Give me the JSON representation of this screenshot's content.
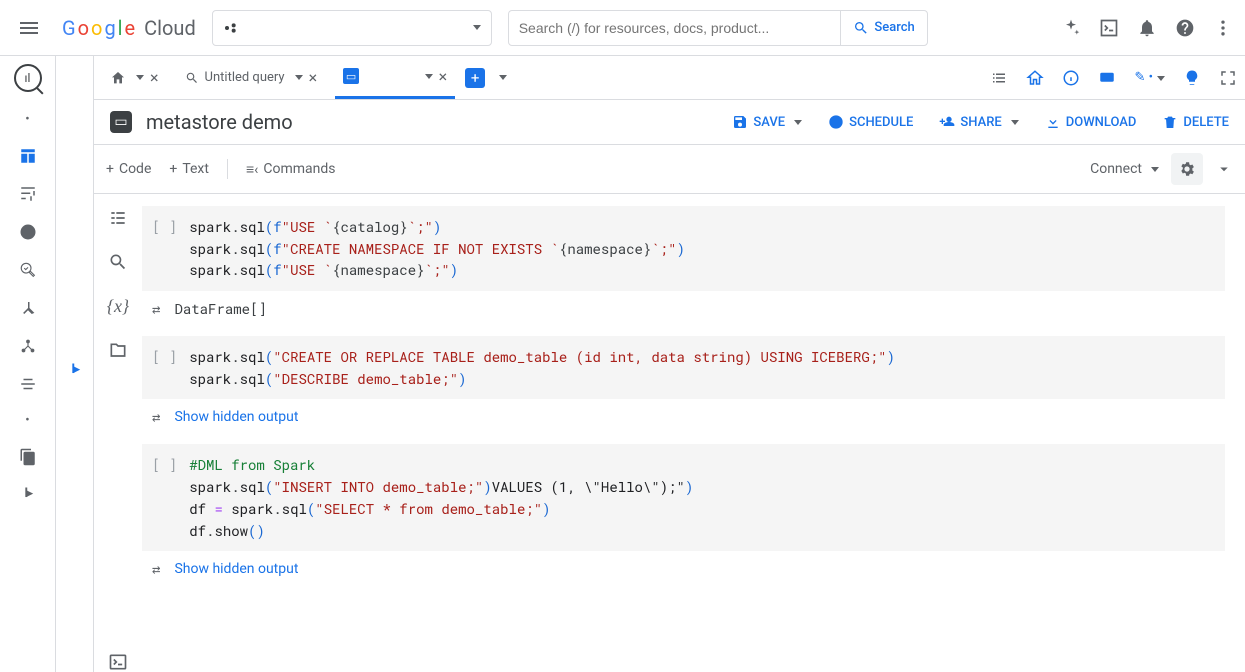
{
  "header": {
    "brand_plain": "Cloud",
    "search_placeholder": "Search (/) for resources, docs, product...",
    "search_btn": "Search"
  },
  "tabs": {
    "untitled": "Untitled query"
  },
  "title": "metastore demo",
  "actions": {
    "save": "SAVE",
    "schedule": "SCHEDULE",
    "share": "SHARE",
    "download": "DOWNLOAD",
    "delete": "DELETE"
  },
  "subbar": {
    "code": "Code",
    "text": "Text",
    "commands": "Commands",
    "connect": "Connect"
  },
  "cell1_output": "DataFrame[]",
  "show_hidden": "Show hidden output",
  "code": {
    "c1l1a": "spark",
    "c1l1b": ".",
    "c1l1c": "sql",
    "c1l1d": "(",
    "c1l1e": "f",
    "c1l1f": "\"USE `",
    "c1l1g": "{catalog}",
    "c1l1h": "`;\"",
    "c1l1i": ")",
    "c1l2a": "spark",
    "c1l2b": ".",
    "c1l2c": "sql",
    "c1l2d": "(",
    "c1l2e": "f",
    "c1l2f": "\"CREATE NAMESPACE IF NOT EXISTS `",
    "c1l2g": "{namespace}",
    "c1l2h": "`;\"",
    "c1l2i": ")",
    "c1l3a": "spark",
    "c1l3b": ".",
    "c1l3c": "sql",
    "c1l3d": "(",
    "c1l3e": "f",
    "c1l3f": "\"USE `",
    "c1l3g": "{namespace}",
    "c1l3h": "`;\"",
    "c1l3i": ")",
    "c2l1a": "spark",
    "c2l1b": ".",
    "c2l1c": "sql",
    "c2l1d": "(",
    "c2l1e": "\"CREATE OR REPLACE TABLE ",
    "c2l1f": "demo_table (id int, data string) USING ICEBERG;\"",
    "c2l1g": ")",
    "c2l2a": "spark",
    "c2l2b": ".",
    "c2l2c": "sql",
    "c2l2d": "(",
    "c2l2e": "\"DESCRIBE ",
    "c2l2f": "demo_table;\"",
    "c2l2g": ")",
    "c3l1": "#DML from Spark",
    "c3l2a": "spark",
    "c3l2b": ".",
    "c3l2c": "sql",
    "c3l2d": "(",
    "c3l2e": "\"INSERT INTO ",
    "c3l2f": "demo_table;\"",
    "c3l2g": ")",
    "c3l2h": "VALUES (1, \\\"Hello\\\");\"",
    "c3l2i": ")",
    "c3l3a": "df ",
    "c3l3b": "=",
    "c3l3c": " spark",
    "c3l3d": ".",
    "c3l3e": "sql",
    "c3l3f": "(",
    "c3l3g": "\"SELECT * from ",
    "c3l3h": "demo_table;\"",
    "c3l3i": ")",
    "c3l4a": "df",
    "c3l4b": ".",
    "c3l4c": "show",
    "c3l4d": "(",
    "c3l4e": ")"
  },
  "prompt": "[ ]"
}
